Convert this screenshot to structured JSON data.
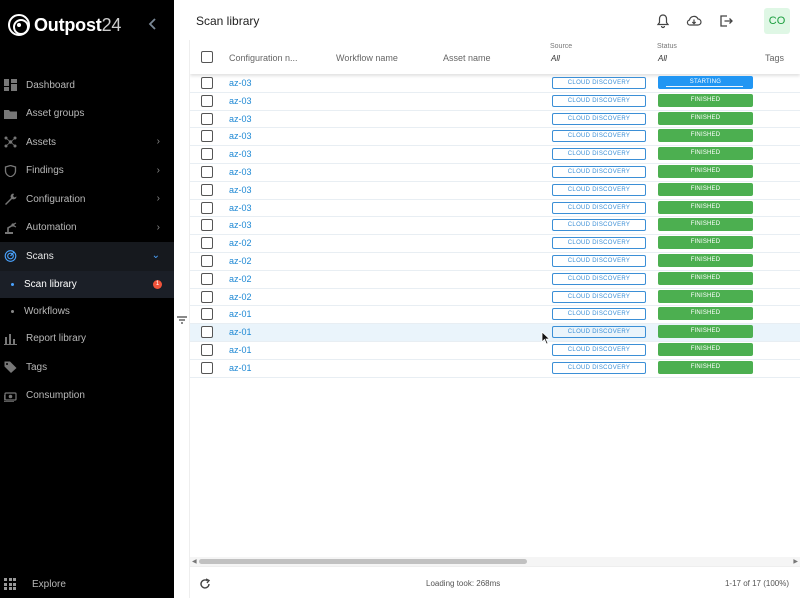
{
  "brand": {
    "name": "Outpost",
    "number": "24"
  },
  "sidebar": {
    "items": [
      {
        "label": "Dashboard",
        "icon": "dashboard-icon",
        "chevron": false
      },
      {
        "label": "Asset groups",
        "icon": "folder-icon",
        "chevron": false
      },
      {
        "label": "Assets",
        "icon": "network-icon",
        "chevron": true
      },
      {
        "label": "Findings",
        "icon": "shield-icon",
        "chevron": true
      },
      {
        "label": "Configuration",
        "icon": "wrench-icon",
        "chevron": true
      },
      {
        "label": "Automation",
        "icon": "robot-arm-icon",
        "chevron": true
      },
      {
        "label": "Scans",
        "icon": "radar-icon",
        "chevron": true,
        "expanded": true
      }
    ],
    "sub_items": [
      {
        "label": "Scan library",
        "badge": "1"
      },
      {
        "label": "Workflows"
      }
    ],
    "items_after": [
      {
        "label": "Report library",
        "icon": "chart-icon"
      },
      {
        "label": "Tags",
        "icon": "tag-icon"
      },
      {
        "label": "Consumption",
        "icon": "money-icon"
      }
    ],
    "explore": "Explore"
  },
  "header": {
    "title": "Scan library",
    "avatar": "CO"
  },
  "table": {
    "columns": {
      "configuration": "Configuration n...",
      "workflow": "Workflow name",
      "asset": "Asset name",
      "source_label": "Source",
      "source_filter": "All",
      "status_label": "Status",
      "status_filter": "All",
      "tags": "Tags"
    },
    "rows": [
      {
        "config": "az-03",
        "source": "CLOUD DISCOVERY",
        "status": "STARTING"
      },
      {
        "config": "az-03",
        "source": "CLOUD DISCOVERY",
        "status": "FINISHED"
      },
      {
        "config": "az-03",
        "source": "CLOUD DISCOVERY",
        "status": "FINISHED"
      },
      {
        "config": "az-03",
        "source": "CLOUD DISCOVERY",
        "status": "FINISHED"
      },
      {
        "config": "az-03",
        "source": "CLOUD DISCOVERY",
        "status": "FINISHED"
      },
      {
        "config": "az-03",
        "source": "CLOUD DISCOVERY",
        "status": "FINISHED"
      },
      {
        "config": "az-03",
        "source": "CLOUD DISCOVERY",
        "status": "FINISHED"
      },
      {
        "config": "az-03",
        "source": "CLOUD DISCOVERY",
        "status": "FINISHED"
      },
      {
        "config": "az-03",
        "source": "CLOUD DISCOVERY",
        "status": "FINISHED"
      },
      {
        "config": "az-02",
        "source": "CLOUD DISCOVERY",
        "status": "FINISHED"
      },
      {
        "config": "az-02",
        "source": "CLOUD DISCOVERY",
        "status": "FINISHED"
      },
      {
        "config": "az-02",
        "source": "CLOUD DISCOVERY",
        "status": "FINISHED"
      },
      {
        "config": "az-02",
        "source": "CLOUD DISCOVERY",
        "status": "FINISHED"
      },
      {
        "config": "az-01",
        "source": "CLOUD DISCOVERY",
        "status": "FINISHED"
      },
      {
        "config": "az-01",
        "source": "CLOUD DISCOVERY",
        "status": "FINISHED"
      },
      {
        "config": "az-01",
        "source": "CLOUD DISCOVERY",
        "status": "FINISHED"
      },
      {
        "config": "az-01",
        "source": "CLOUD DISCOVERY",
        "status": "FINISHED"
      }
    ]
  },
  "footer": {
    "loading": "Loading took: 268ms",
    "pagination": "1-17 of 17 (100%)"
  },
  "colors": {
    "finished": "#4caf50",
    "starting": "#2196f3",
    "link": "#1e88d4",
    "sidebar_bg": "#000000"
  }
}
